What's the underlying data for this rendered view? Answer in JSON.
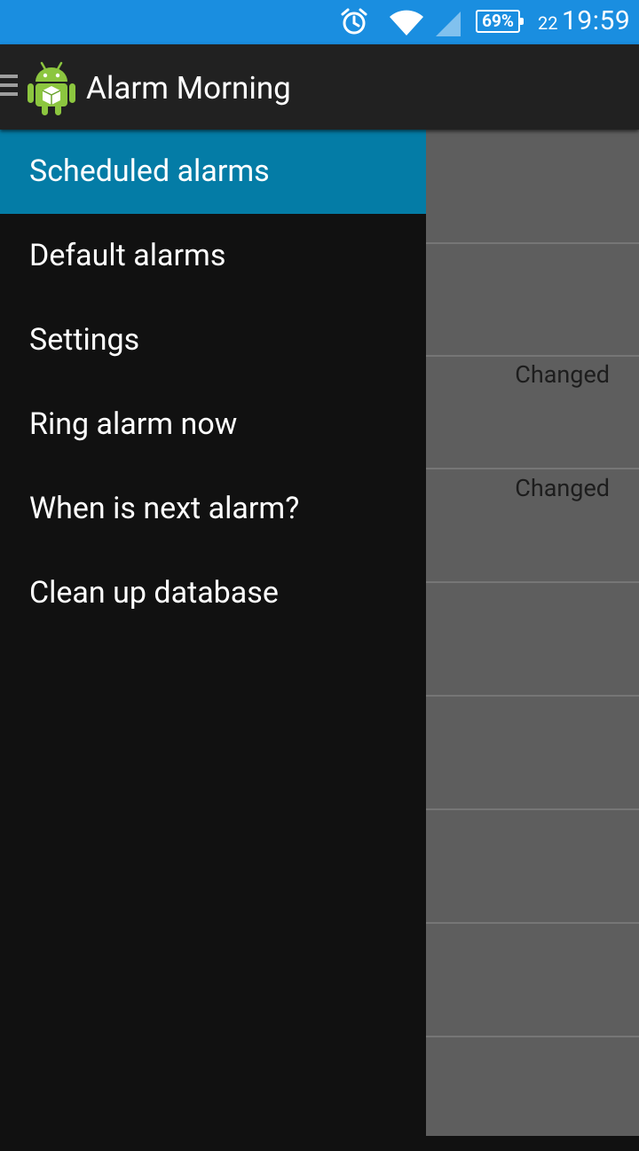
{
  "status_bar": {
    "battery": "69%",
    "date": "22",
    "time": "19:59",
    "icons": [
      "alarm-clock-icon",
      "wifi-icon",
      "signal-icon",
      "battery-icon"
    ]
  },
  "action_bar": {
    "title": "Alarm Morning",
    "icons": [
      "hamburger-icon",
      "android-app-icon"
    ]
  },
  "drawer": {
    "items": [
      {
        "label": "Scheduled alarms",
        "selected": true
      },
      {
        "label": "Default alarms",
        "selected": false
      },
      {
        "label": "Settings",
        "selected": false
      },
      {
        "label": "Ring alarm now",
        "selected": false
      },
      {
        "label": "When is next alarm?",
        "selected": false
      },
      {
        "label": "Clean up database",
        "selected": false
      }
    ]
  },
  "background_list": {
    "changed_labels": [
      "Changed",
      "Changed"
    ]
  },
  "colors": {
    "status_bar": "#1a8ee0",
    "action_bar": "#212121",
    "drawer_bg": "#111111",
    "selected_item": "#047ca6",
    "content_bg": "#5e5e5e"
  }
}
